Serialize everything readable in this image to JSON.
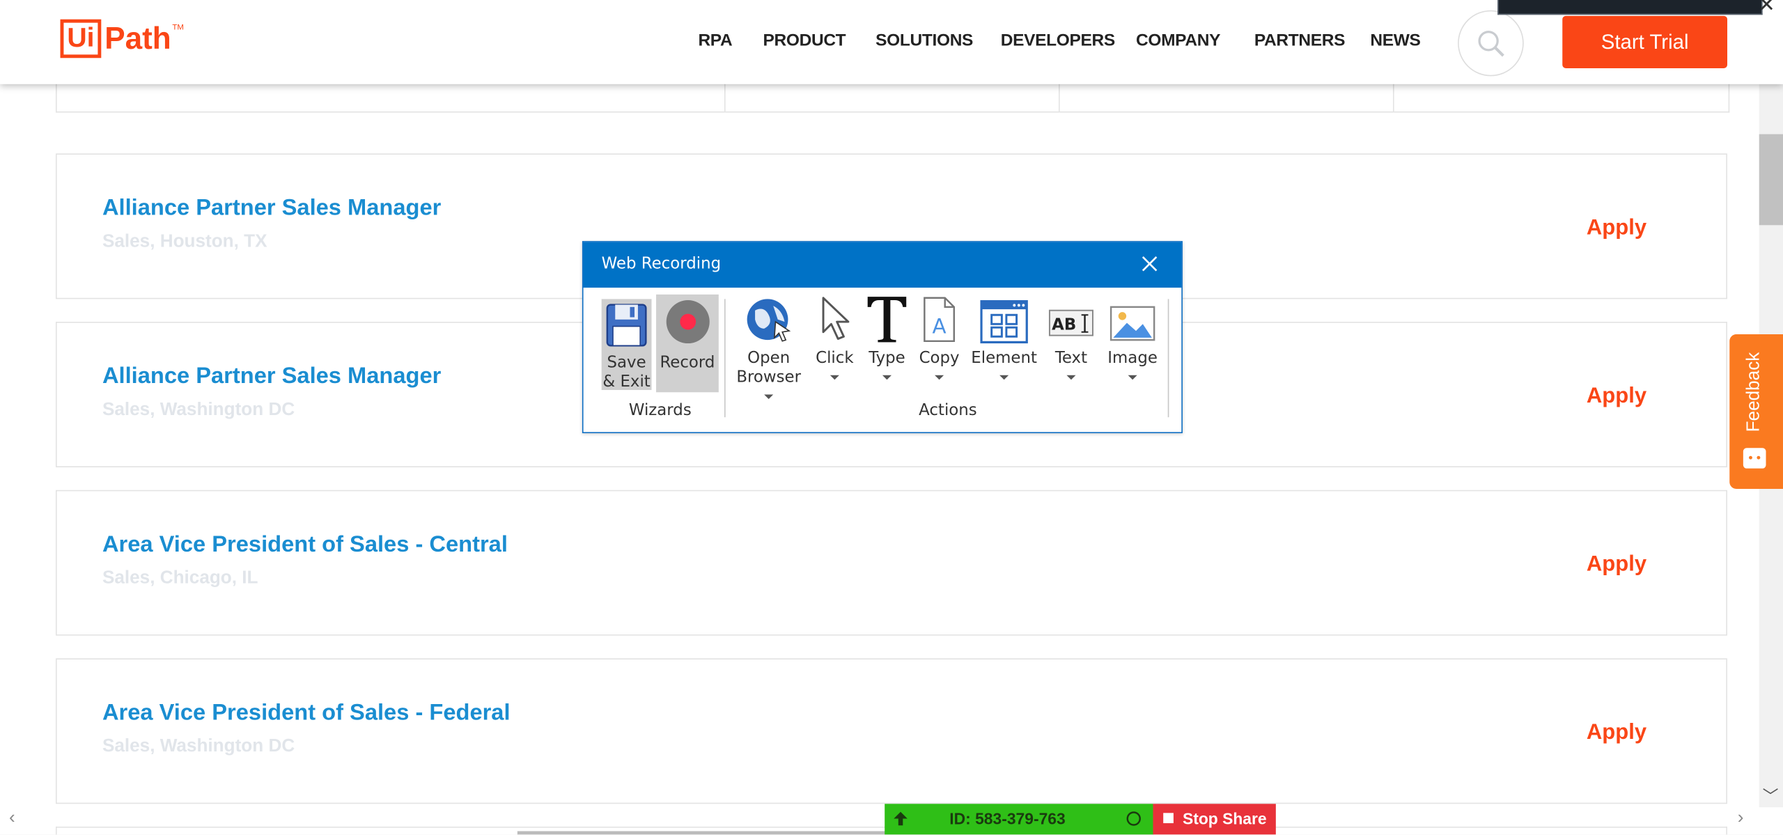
{
  "header": {
    "logo_ui": "Ui",
    "logo_path": "Path",
    "logo_tm": "TM",
    "nav": [
      "RPA",
      "PRODUCT",
      "SOLUTIONS",
      "DEVELOPERS",
      "COMPANY",
      "PARTNERS",
      "NEWS"
    ],
    "start_trial": "Start Trial"
  },
  "jobs": [
    {
      "title": "Alliance Partner Sales Manager",
      "subtitle": "Sales, Houston, TX",
      "apply": "Apply"
    },
    {
      "title": "Alliance Partner Sales Manager",
      "subtitle": "Sales, Washington DC",
      "apply": "Apply"
    },
    {
      "title": "Area Vice President of Sales - Central",
      "subtitle": "Sales, Chicago, IL",
      "apply": "Apply"
    },
    {
      "title": "Area Vice President of Sales - Federal",
      "subtitle": "Sales, Washington DC",
      "apply": "Apply"
    }
  ],
  "feedback": {
    "label": "Feedback"
  },
  "dialog": {
    "title": "Web Recording",
    "wizards": {
      "label": "Wizards",
      "save_exit_line1": "Save",
      "save_exit_line2": "& Exit",
      "record": "Record"
    },
    "actions": {
      "label": "Actions",
      "open_browser_line1": "Open",
      "open_browser_line2": "Browser",
      "click": "Click",
      "type": "Type",
      "copy": "Copy",
      "element": "Element",
      "text": "Text",
      "image": "Image",
      "text_icon_label": "AB"
    }
  },
  "share_bar": {
    "id": "ID: 583-379-763",
    "stop": "Stop Share"
  },
  "colors": {
    "brand_orange": "#fa4616",
    "link_blue": "#1a8dd1",
    "dialog_blue": "#0072c6",
    "share_green": "#2fbf17",
    "share_red": "#e8323a"
  }
}
